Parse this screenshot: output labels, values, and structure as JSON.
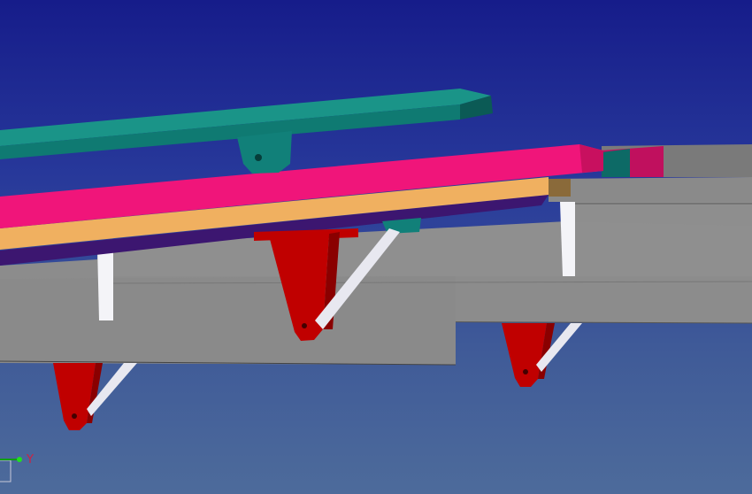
{
  "viewport": {
    "background_top": "#161c8a",
    "background_bottom": "#4d6b9b",
    "axis_triad": {
      "axis_label": "Y"
    }
  },
  "model": {
    "colors": {
      "teal_rail": "#138a80",
      "pink_beam": "#f0157a",
      "orange_strip": "#f0b060",
      "purple_strip": "#3c1670",
      "gray_beam": "#8c8c8c",
      "red_bracket": "#c00000",
      "white_strut": "#e8e8f0"
    }
  }
}
